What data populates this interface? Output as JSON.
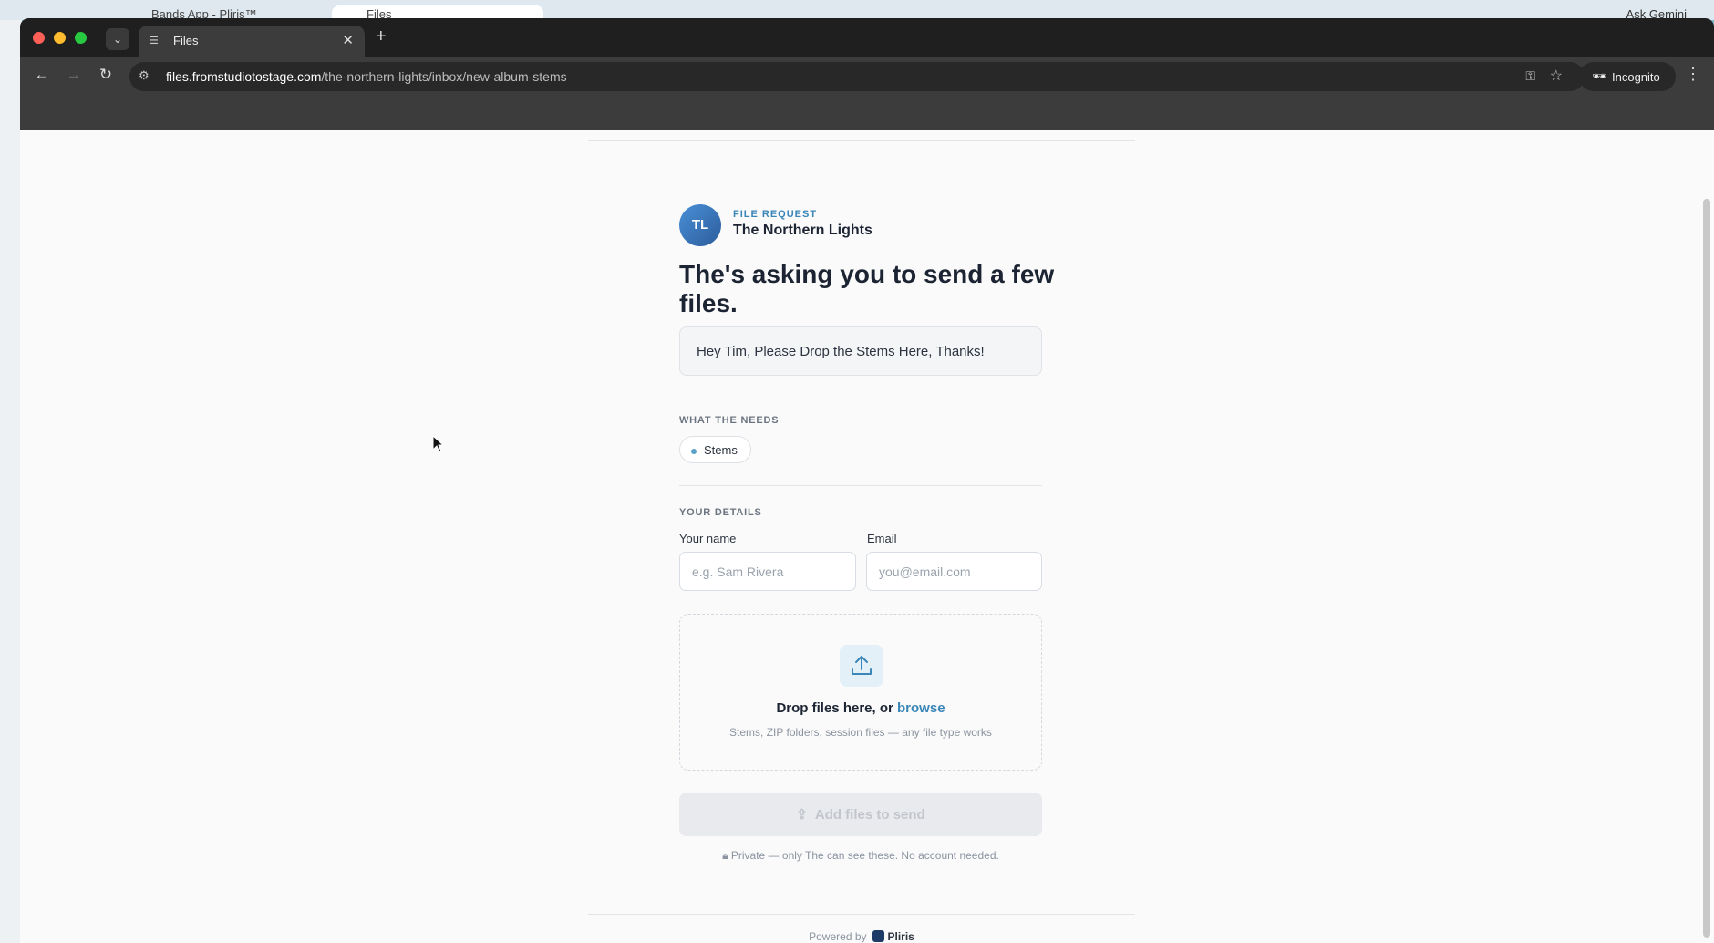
{
  "background": {
    "tab1_title": "Bands App - Pliris™",
    "tab2_title": "Files",
    "gemini_label": "Ask Gemini"
  },
  "browser": {
    "tab_title": "Files",
    "url_host": "files.fromstudiotostage.com",
    "url_path": "/the-northern-lights/inbox/new-album-stems",
    "incognito_label": "Incognito"
  },
  "page": {
    "avatar_initials": "TL",
    "kicker": "FILE REQUEST",
    "band_name": "The Northern Lights",
    "heading": "The's asking you to send a few files.",
    "message": "Hey Tim, Please Drop the Stems Here, Thanks!",
    "needs_label": "WHAT THE NEEDS",
    "needs": [
      "Stems"
    ],
    "details_label": "YOUR DETAILS",
    "name_label": "Your name",
    "name_placeholder": "e.g. Sam Rivera",
    "email_label": "Email",
    "email_placeholder": "you@email.com",
    "drop_text": "Drop files here, or",
    "browse_text": "browse",
    "drop_sub": "Stems, ZIP folders, session files — any file type works",
    "send_button": "Add files to send",
    "privacy": "Private — only The can see these. No account needed.",
    "powered_by": "Powered by",
    "brand": "Pliris"
  },
  "colors": {
    "accent": "#3a86b8",
    "heading": "#1c2433",
    "avatar": "#3a74b8"
  }
}
